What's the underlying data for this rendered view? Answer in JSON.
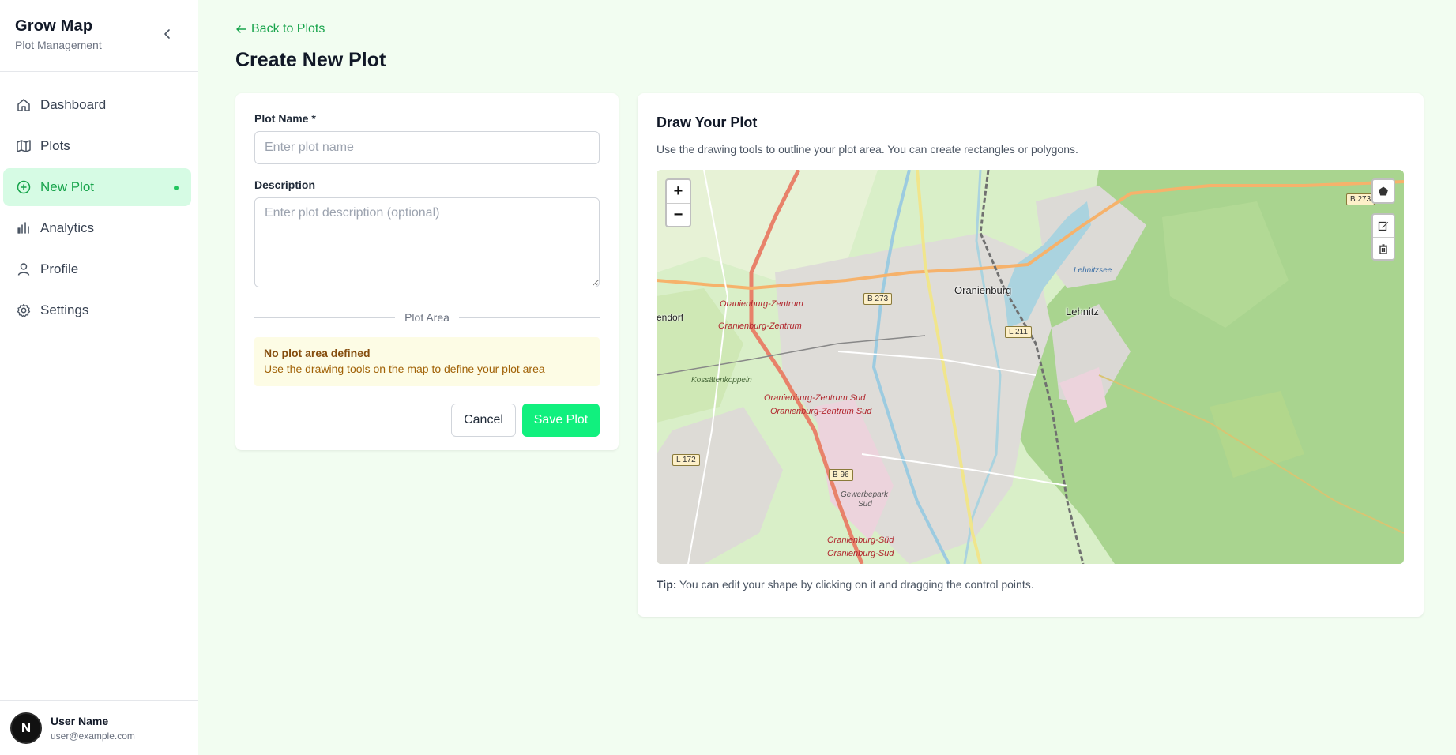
{
  "sidebar": {
    "brand_title": "Grow Map",
    "brand_subtitle": "Plot Management",
    "items": [
      {
        "label": "Dashboard",
        "icon": "home-icon"
      },
      {
        "label": "Plots",
        "icon": "map-icon"
      },
      {
        "label": "New Plot",
        "icon": "plus-circle-icon",
        "active": true
      },
      {
        "label": "Analytics",
        "icon": "bar-chart-icon"
      },
      {
        "label": "Profile",
        "icon": "user-icon"
      },
      {
        "label": "Settings",
        "icon": "gear-icon"
      }
    ],
    "user": {
      "initial": "N",
      "name": "User Name",
      "email": "user@example.com"
    }
  },
  "header": {
    "back_label": "Back to Plots",
    "title": "Create New Plot"
  },
  "form": {
    "name_label": "Plot Name *",
    "name_placeholder": "Enter plot name",
    "name_value": "",
    "description_label": "Description",
    "description_placeholder": "Enter plot description (optional)",
    "description_value": "",
    "divider_label": "Plot Area",
    "warning_title": "No plot area defined",
    "warning_text": "Use the drawing tools on the map to define your plot area",
    "cancel_label": "Cancel",
    "save_label": "Save Plot"
  },
  "map_panel": {
    "title": "Draw Your Plot",
    "description": "Use the drawing tools to outline your plot area. You can create rectangles or polygons.",
    "zoom_in": "+",
    "zoom_out": "−",
    "tip_bold": "Tip:",
    "tip_text": " You can edit your shape by clicking on it and dragging the control points.",
    "labels": {
      "oranienburg": "Oranienburg",
      "lehnitz": "Lehnitz",
      "lehnitzsee": "Lehnitzsee",
      "endorf": "endorf",
      "station1": "Oranienburg-Zentrum",
      "station2": "Oranienburg-Zentrum",
      "station3": "Oranienburg-Zentrum Sud",
      "station4": "Oranienburg-Zentrum Sud",
      "kossaten": "Kossätenkoppeln",
      "gewerbe1": "Gewerbepark",
      "gewerbe2": "Sud",
      "sued1": "Oranienburg-Süd",
      "sued2": "Oranienburg-Sud",
      "b273a": "B 273",
      "b273b": "B 273",
      "l211": "L 211",
      "l172": "L 172",
      "b96": "B 96"
    }
  },
  "colors": {
    "accent": "#16a34a",
    "active_bg": "#d6fbe4",
    "save_button": "#11f07e",
    "page_bg": "#f2fdf1",
    "warning_bg": "#fdfce5"
  }
}
